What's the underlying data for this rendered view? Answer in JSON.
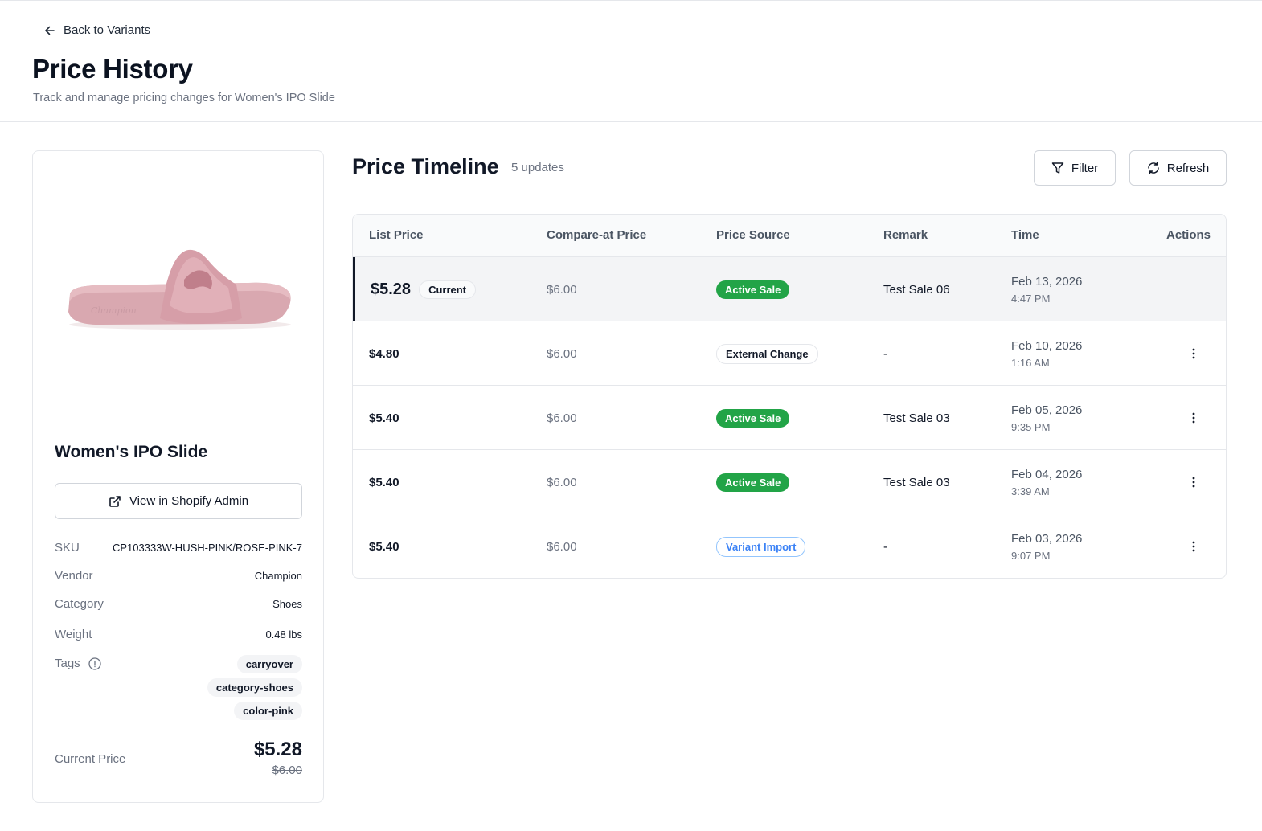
{
  "header": {
    "back_label": "Back to Variants",
    "title": "Price History",
    "subtitle": "Track and manage pricing changes for Women's IPO Slide"
  },
  "product": {
    "name": "Women's IPO Slide",
    "shopify_button": "View in Shopify Admin",
    "image_brand_text": "Champion",
    "meta": {
      "sku_label": "SKU",
      "sku_value": "CP103333W-HUSH-PINK/ROSE-PINK-7",
      "vendor_label": "Vendor",
      "vendor_value": "Champion",
      "category_label": "Category",
      "category_value": "Shoes",
      "weight_label": "Weight",
      "weight_value": "0.48 lbs",
      "tags_label": "Tags",
      "tags": [
        "carryover",
        "category-shoes",
        "color-pink"
      ]
    },
    "current_price_label": "Current Price",
    "current_price": "$5.28",
    "compare_price": "$6.00"
  },
  "timeline": {
    "title": "Price Timeline",
    "count": "5 updates",
    "filter_label": "Filter",
    "refresh_label": "Refresh",
    "columns": [
      "List Price",
      "Compare-at Price",
      "Price Source",
      "Remark",
      "Time",
      "Actions"
    ],
    "rows": [
      {
        "list_price": "$5.28",
        "current_label": "Current",
        "compare": "$6.00",
        "source": "Active Sale",
        "remark": "Test Sale 06",
        "date": "Feb 13, 2026",
        "time": "4:47 PM"
      },
      {
        "list_price": "$4.80",
        "compare": "$6.00",
        "source": "External Change",
        "remark": "-",
        "date": "Feb 10, 2026",
        "time": "1:16 AM"
      },
      {
        "list_price": "$5.40",
        "compare": "$6.00",
        "source": "Active Sale",
        "remark": "Test Sale 03",
        "date": "Feb 05, 2026",
        "time": "9:35 PM"
      },
      {
        "list_price": "$5.40",
        "compare": "$6.00",
        "source": "Active Sale",
        "remark": "Test Sale 03",
        "date": "Feb 04, 2026",
        "time": "3:39 AM"
      },
      {
        "list_price": "$5.40",
        "compare": "$6.00",
        "source": "Variant Import",
        "remark": "-",
        "date": "Feb 03, 2026",
        "time": "9:07 PM"
      }
    ]
  },
  "colors": {
    "active_sale": "#22a447",
    "variant_import": "#3b82f6",
    "current_row_bg": "#f3f4f6"
  },
  "icons": {
    "back": "arrow-left-icon",
    "external": "external-link-icon",
    "filter": "filter-icon",
    "refresh": "refresh-icon",
    "info": "info-icon",
    "actions": "more-vertical-icon"
  }
}
